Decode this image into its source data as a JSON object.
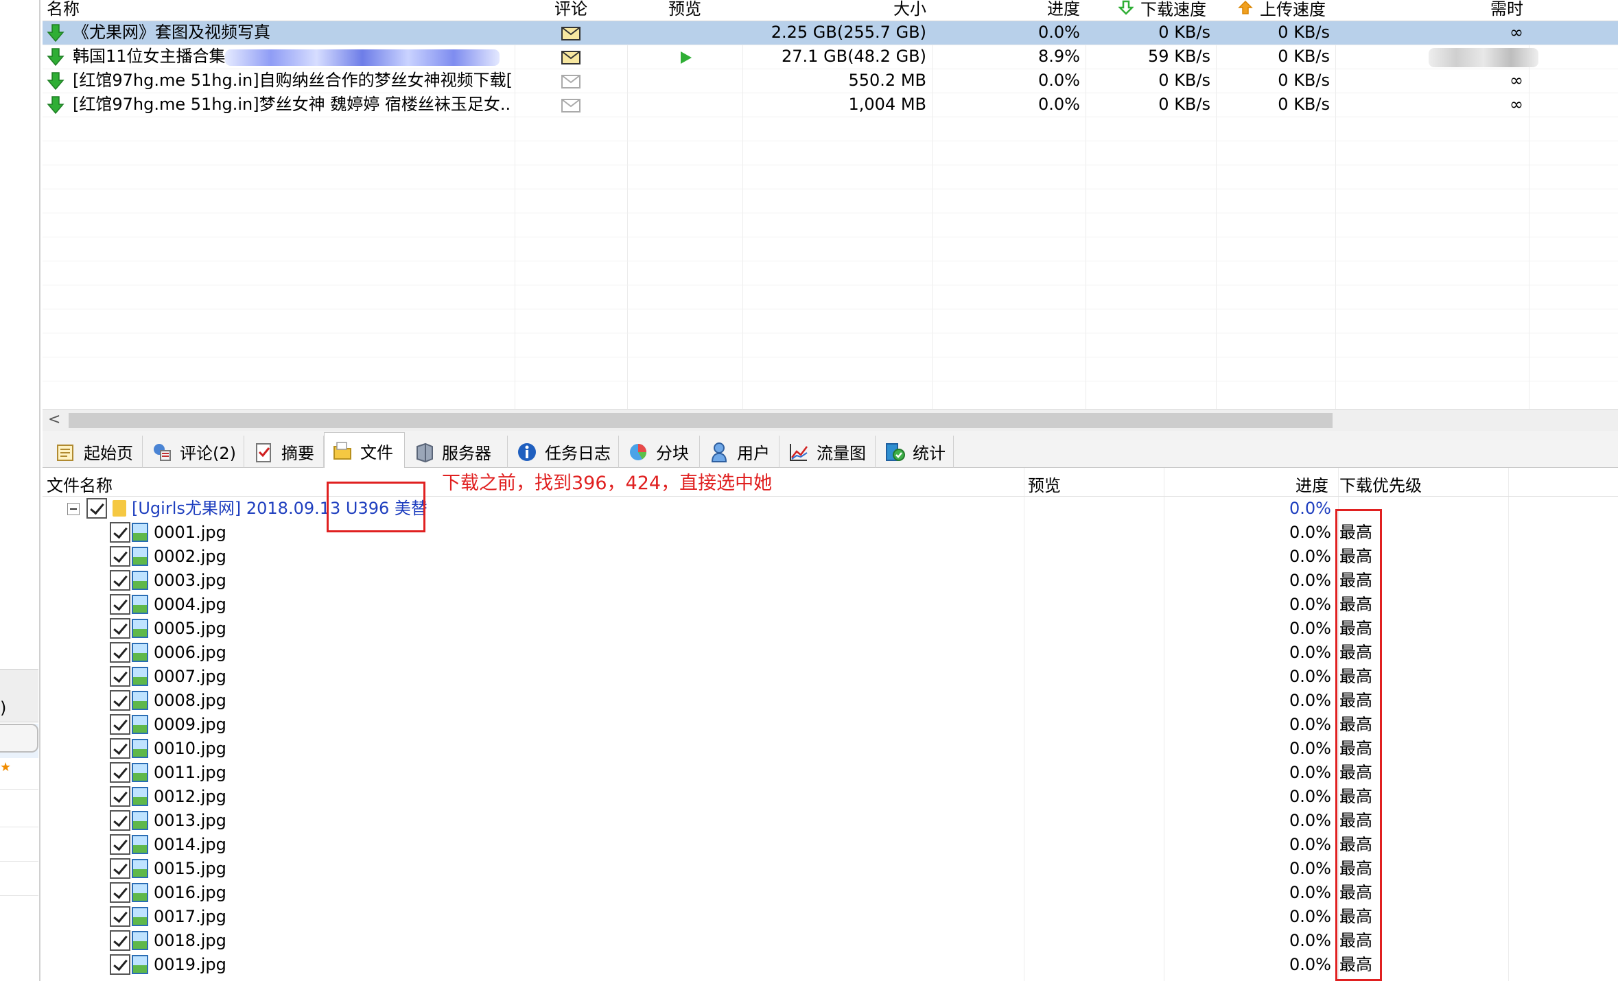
{
  "list": {
    "columns": {
      "name": "名称",
      "comment": "评论",
      "preview": "预览",
      "size": "大小",
      "progress": "进度",
      "down_speed": "下载速度",
      "up_speed": "上传速度",
      "eta": "需时"
    },
    "rows": [
      {
        "name": "《尤果网》套图及视频写真",
        "size": "2.25 GB(255.7 GB)",
        "progress": "0.0%",
        "down": "0 KB/s",
        "up": "0 KB/s",
        "eta": "∞"
      },
      {
        "name": "韩国11位女主播合集",
        "size": "27.1 GB(48.2 GB)",
        "progress": "8.9%",
        "down": "59 KB/s",
        "up": "0 KB/s",
        "eta": ""
      },
      {
        "name": "[红馆97hg.me 51hg.in]自购纳丝合作的梦丝女神视频下载[...",
        "size": "550.2 MB",
        "progress": "0.0%",
        "down": "0 KB/s",
        "up": "0 KB/s",
        "eta": "∞"
      },
      {
        "name": "[红馆97hg.me 51hg.in]梦丝女神 魏婷婷 宿楼丝袜玉足女...",
        "size": "1,004 MB",
        "progress": "0.0%",
        "down": "0 KB/s",
        "up": "0 KB/s",
        "eta": "∞"
      }
    ]
  },
  "scrollbar": {
    "left_arrow": "<"
  },
  "tabs": [
    {
      "label": "起始页",
      "icon": "home-page-icon"
    },
    {
      "label": "评论(2)",
      "icon": "comments-icon"
    },
    {
      "label": "摘要",
      "icon": "summary-icon"
    },
    {
      "label": "文件",
      "icon": "files-icon"
    },
    {
      "label": "服务器",
      "icon": "server-icon"
    },
    {
      "label": "任务日志",
      "icon": "task-log-icon"
    },
    {
      "label": "分块",
      "icon": "pieces-icon"
    },
    {
      "label": "用户",
      "icon": "users-icon"
    },
    {
      "label": "流量图",
      "icon": "traffic-chart-icon"
    },
    {
      "label": "统计",
      "icon": "statistics-icon"
    }
  ],
  "files": {
    "columns": {
      "name": "文件名称",
      "preview": "预览",
      "progress": "进度",
      "priority": "下载优先级"
    },
    "folder": {
      "name_part1": "[Ugirls尤果网] 2018.09.13 ",
      "name_part2": "U396 美替",
      "progress": "0.0%"
    },
    "items": [
      {
        "name": "0001.jpg",
        "progress": "0.0%",
        "priority": "最高"
      },
      {
        "name": "0002.jpg",
        "progress": "0.0%",
        "priority": "最高"
      },
      {
        "name": "0003.jpg",
        "progress": "0.0%",
        "priority": "最高"
      },
      {
        "name": "0004.jpg",
        "progress": "0.0%",
        "priority": "最高"
      },
      {
        "name": "0005.jpg",
        "progress": "0.0%",
        "priority": "最高"
      },
      {
        "name": "0006.jpg",
        "progress": "0.0%",
        "priority": "最高"
      },
      {
        "name": "0007.jpg",
        "progress": "0.0%",
        "priority": "最高"
      },
      {
        "name": "0008.jpg",
        "progress": "0.0%",
        "priority": "最高"
      },
      {
        "name": "0009.jpg",
        "progress": "0.0%",
        "priority": "最高"
      },
      {
        "name": "0010.jpg",
        "progress": "0.0%",
        "priority": "最高"
      },
      {
        "name": "0011.jpg",
        "progress": "0.0%",
        "priority": "最高"
      },
      {
        "name": "0012.jpg",
        "progress": "0.0%",
        "priority": "最高"
      },
      {
        "name": "0013.jpg",
        "progress": "0.0%",
        "priority": "最高"
      },
      {
        "name": "0014.jpg",
        "progress": "0.0%",
        "priority": "最高"
      },
      {
        "name": "0015.jpg",
        "progress": "0.0%",
        "priority": "最高"
      },
      {
        "name": "0016.jpg",
        "progress": "0.0%",
        "priority": "最高"
      },
      {
        "name": "0017.jpg",
        "progress": "0.0%",
        "priority": "最高"
      },
      {
        "name": "0018.jpg",
        "progress": "0.0%",
        "priority": "最高"
      },
      {
        "name": "0019.jpg",
        "progress": "0.0%",
        "priority": "最高"
      }
    ]
  },
  "annotation": {
    "text": "下载之前，找到396，424，直接选中她",
    "color": "#e02020"
  },
  "left_strip": {
    "paren": ")",
    "star": "★"
  },
  "colors": {
    "selected_row": "#b8d0ea",
    "folder_link": "#1f3fbf",
    "download_arrow": "#2fae35",
    "upload_arrow": "#f0a020"
  }
}
